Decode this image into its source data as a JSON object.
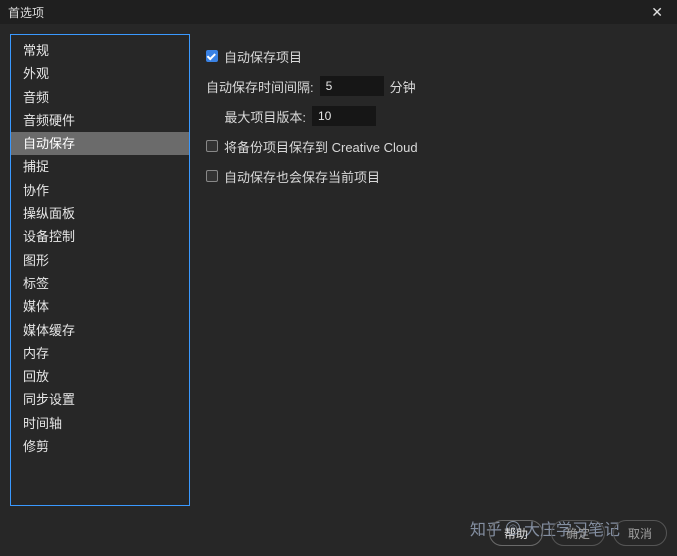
{
  "window": {
    "title": "首选项"
  },
  "sidebar": {
    "items": [
      {
        "label": "常规"
      },
      {
        "label": "外观"
      },
      {
        "label": "音频"
      },
      {
        "label": "音频硬件"
      },
      {
        "label": "自动保存"
      },
      {
        "label": "捕捉"
      },
      {
        "label": "协作"
      },
      {
        "label": "操纵面板"
      },
      {
        "label": "设备控制"
      },
      {
        "label": "图形"
      },
      {
        "label": "标签"
      },
      {
        "label": "媒体"
      },
      {
        "label": "媒体缓存"
      },
      {
        "label": "内存"
      },
      {
        "label": "回放"
      },
      {
        "label": "同步设置"
      },
      {
        "label": "时间轴"
      },
      {
        "label": "修剪"
      }
    ],
    "selected_index": 4
  },
  "settings": {
    "auto_save_enabled_label": "自动保存项目",
    "interval_label": "自动保存时间间隔:",
    "interval_value": "5",
    "interval_unit": "分钟",
    "max_versions_label": "最大项目版本:",
    "max_versions_value": "10",
    "backup_cc_label": "将备份项目保存到 Creative Cloud",
    "also_save_current_label": "自动保存也会保存当前项目"
  },
  "footer": {
    "help": "帮助",
    "ok": "确定",
    "cancel": "取消"
  },
  "watermark": {
    "brand": "知乎",
    "user": "大庄学习笔记"
  }
}
